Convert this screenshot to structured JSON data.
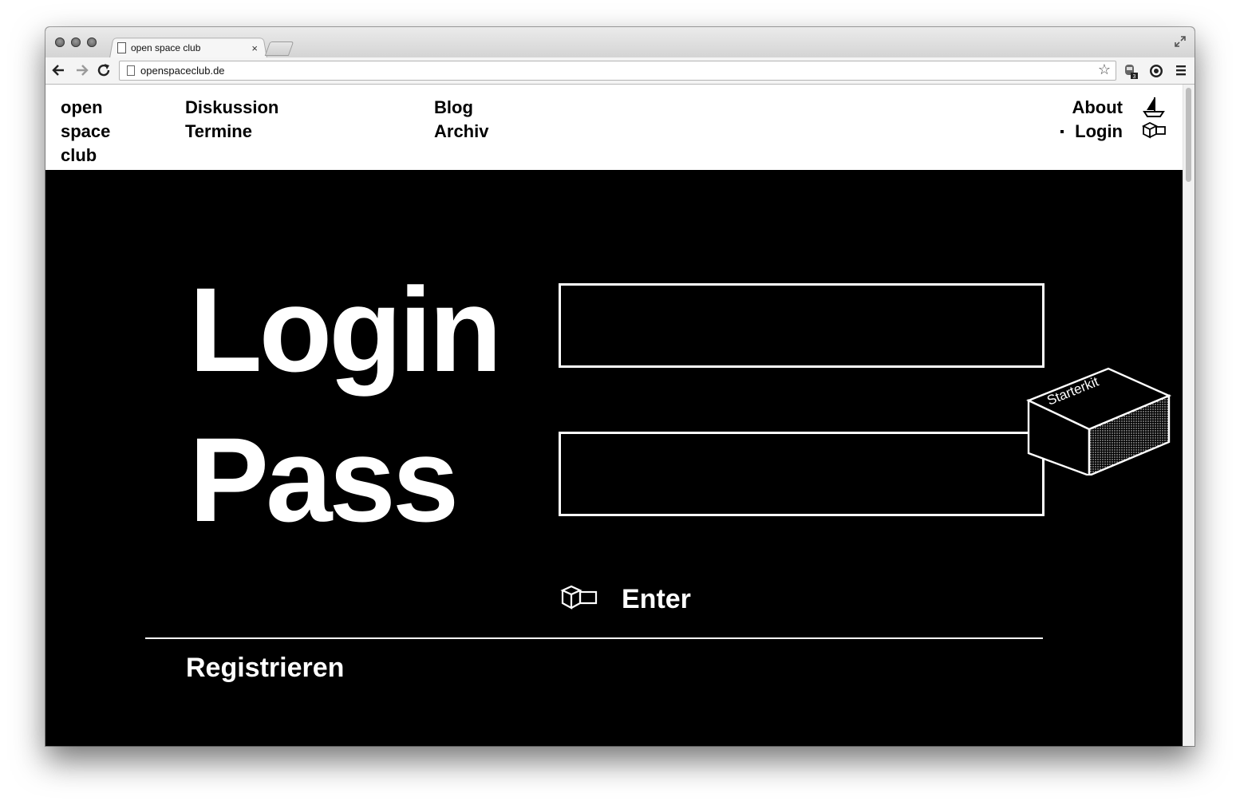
{
  "browser": {
    "tab_title": "open space club",
    "tab_close": "×",
    "url": "openspaceclub.de",
    "extension_badge": "3"
  },
  "site": {
    "logo_lines": [
      "open",
      "space",
      "club"
    ],
    "nav_col1": [
      "Diskussion",
      "Termine"
    ],
    "nav_col2": [
      "Blog",
      "Archiv"
    ],
    "nav_right": [
      "About",
      "Login"
    ],
    "active_item": "Login"
  },
  "login_form": {
    "login_label": "Login",
    "pass_label": "Pass",
    "login_value": "",
    "pass_value": "",
    "enter_label": "Enter",
    "register_label": "Registrieren",
    "starterkit_label": "Starterkit"
  }
}
